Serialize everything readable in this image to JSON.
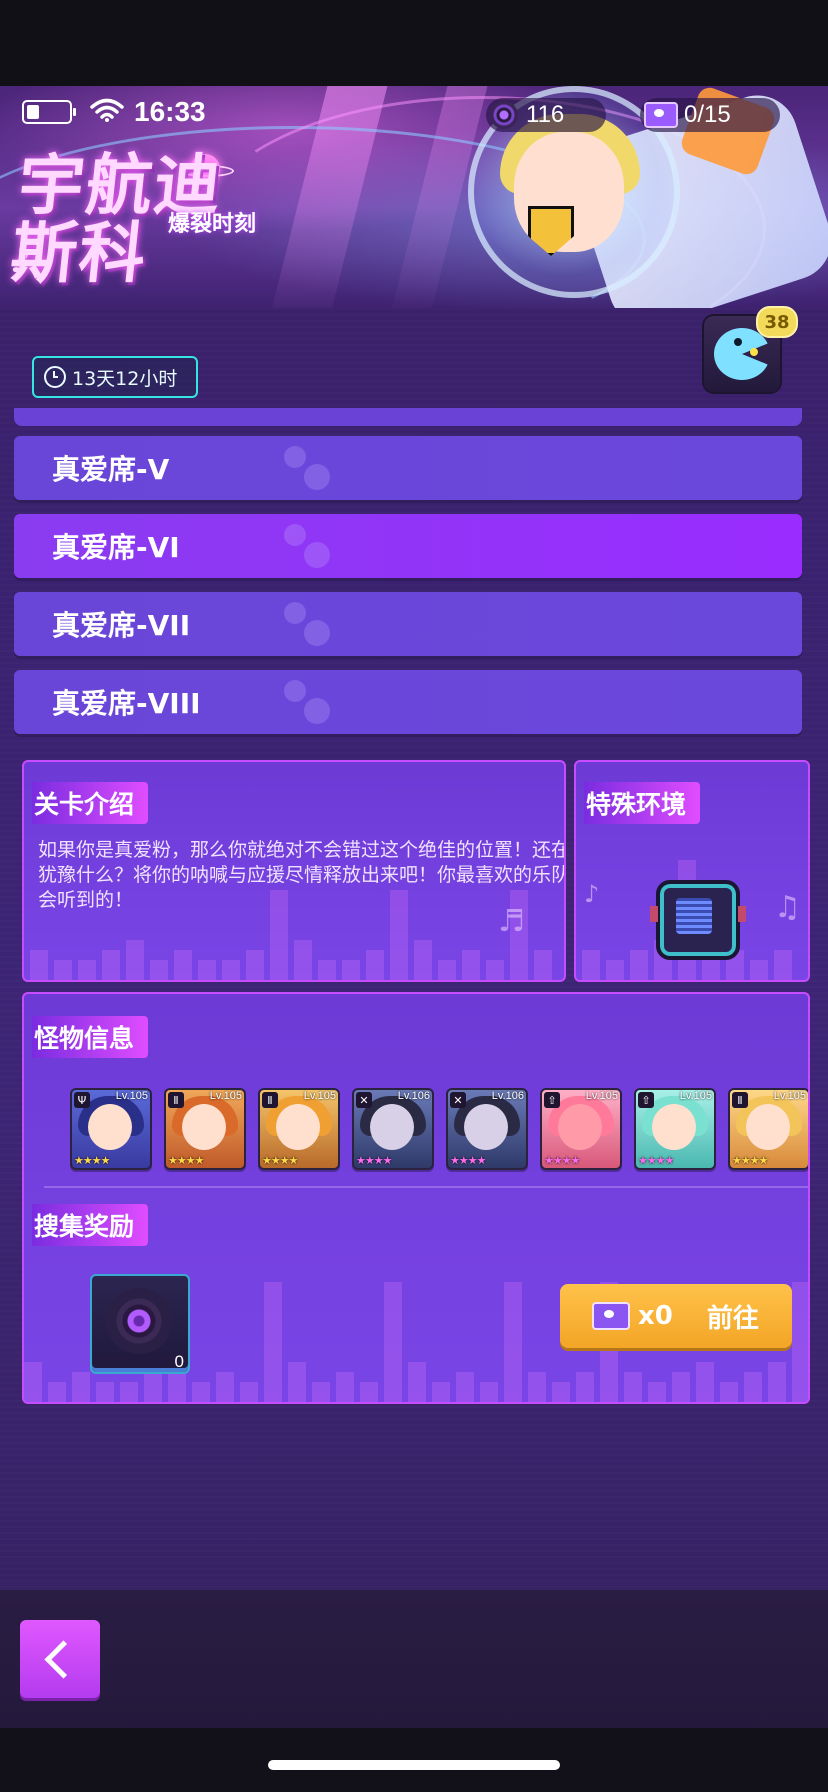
{
  "status_bar": {
    "time": "16:33",
    "discs": "116",
    "tickets": "0/15"
  },
  "banner": {
    "title": "宇航迪斯科",
    "subtitle": "爆裂时刻"
  },
  "timer": {
    "text": "13天12小时"
  },
  "pacman_badge": "38",
  "tiers": [
    {
      "label": "真爱席-V",
      "active": false
    },
    {
      "label": "真爱席-VI",
      "active": true
    },
    {
      "label": "真爱席-VII",
      "active": false
    },
    {
      "label": "真爱席-VIII",
      "active": false
    }
  ],
  "stage_intro": {
    "heading": "关卡介绍",
    "text": "如果你是真爱粉，那么你就绝对不会错过这个绝佳的位置！还在犹豫什么？将你的呐喊与应援尽情释放出来吧！你最喜欢的乐队会听到的！"
  },
  "special_env": {
    "heading": "特殊环境"
  },
  "monster_info": {
    "heading": "怪物信息",
    "monsters": [
      {
        "level": "Lv.105",
        "class_icon": "mage-icon",
        "stars": "★★★★",
        "star_color": "#ffd84a",
        "hair": "#2a2f8a"
      },
      {
        "level": "Lv.105",
        "class_icon": "warrior-icon",
        "stars": "★★★★",
        "star_color": "#ffd84a",
        "hair": "#d96a2a"
      },
      {
        "level": "Lv.105",
        "class_icon": "warrior-icon",
        "stars": "★★★★",
        "star_color": "#ffd84a",
        "hair": "#f0a032"
      },
      {
        "level": "Lv.106",
        "class_icon": "assassin-icon",
        "stars": "★★★★",
        "star_color": "#ff6bf0",
        "hair": "#2a2a44"
      },
      {
        "level": "Lv.106",
        "class_icon": "assassin-icon",
        "stars": "★★★★",
        "star_color": "#ff6bf0",
        "hair": "#2a2a44"
      },
      {
        "level": "Lv.105",
        "class_icon": "support-icon",
        "stars": "★★★★",
        "star_color": "#ff6bf0",
        "hair": "#ff7a9a"
      },
      {
        "level": "Lv.105",
        "class_icon": "support-icon",
        "stars": "★★★★",
        "star_color": "#ff6bf0",
        "hair": "#7ae0d0"
      },
      {
        "level": "Lv.105",
        "class_icon": "warrior-icon",
        "stars": "★★★★",
        "star_color": "#ffd84a",
        "hair": "#f2c45a"
      }
    ]
  },
  "rewards": {
    "heading": "搜集奖励",
    "item_count": "0",
    "ticket_cost": "x0",
    "go_label": "前往"
  }
}
